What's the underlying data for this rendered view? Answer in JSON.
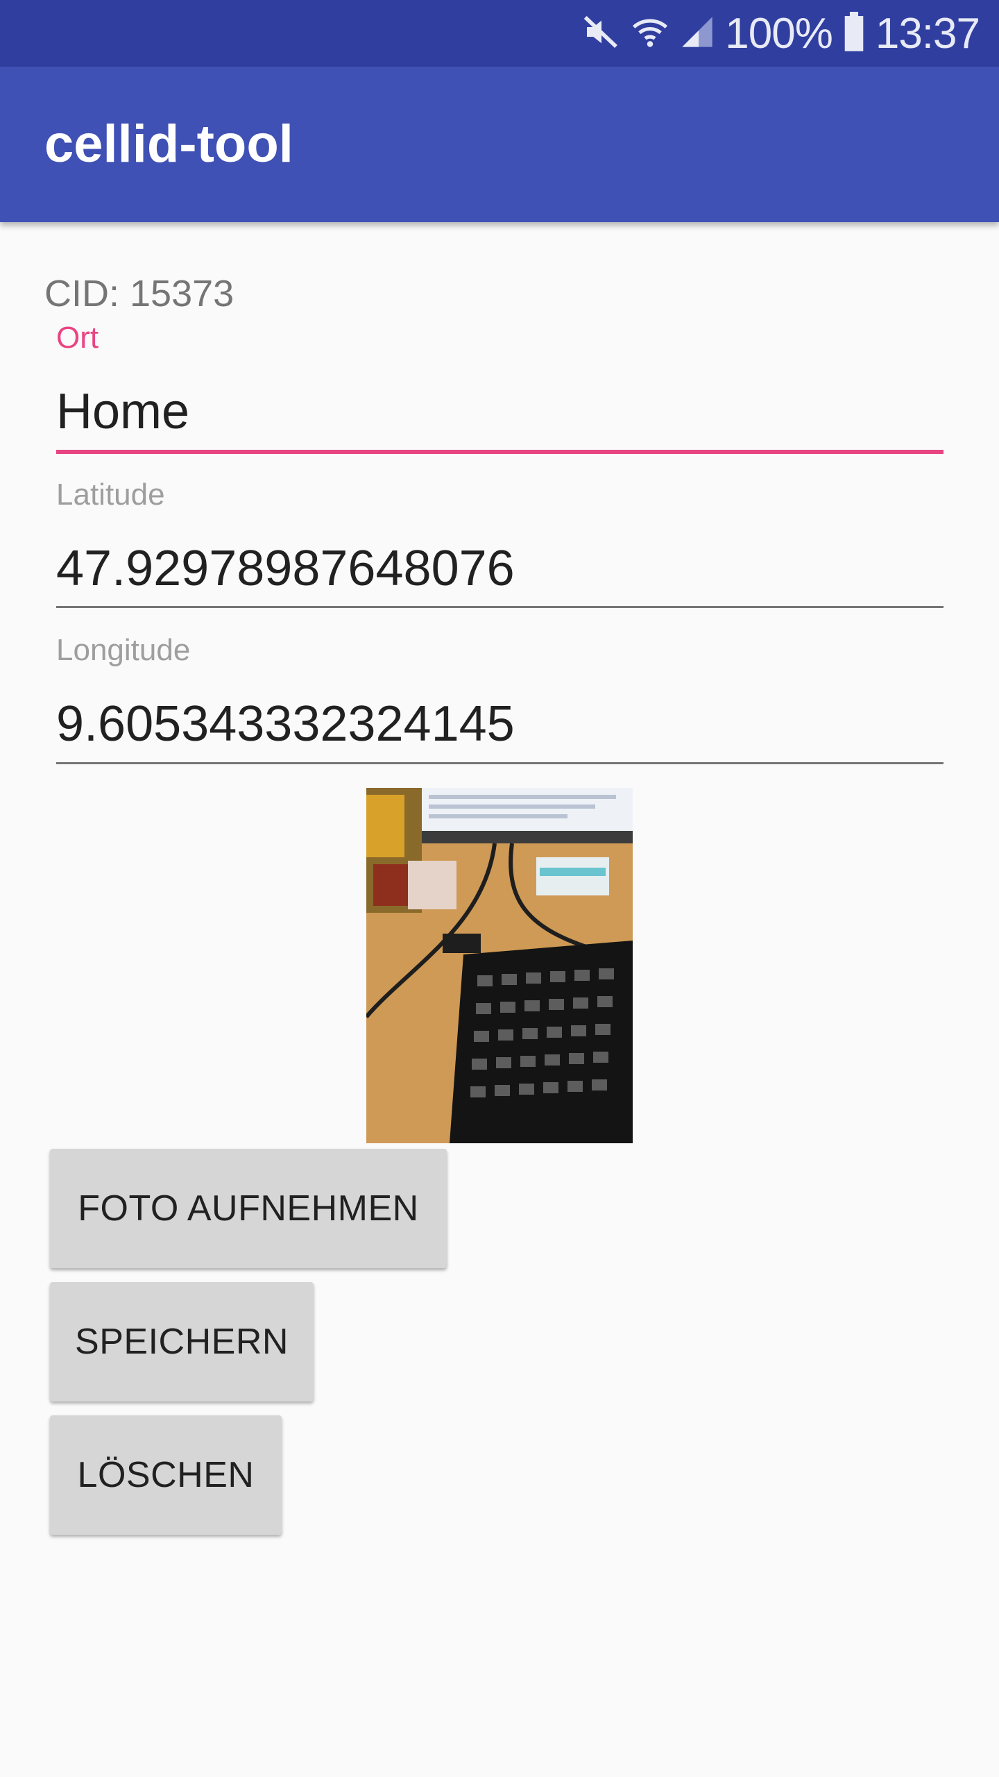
{
  "status_bar": {
    "battery_percent": "100%",
    "time": "13:37",
    "icons": [
      "mute-icon",
      "wifi-icon",
      "signal-icon",
      "battery-icon"
    ]
  },
  "app_bar": {
    "title": "cellid-tool",
    "color": "#3f51b5"
  },
  "form": {
    "cid": "CID: 15373",
    "ort": {
      "label": "Ort",
      "value": "Home"
    },
    "latitude": {
      "label": "Latitude",
      "value": "47.92978987648076"
    },
    "longitude": {
      "label": "Longitude",
      "value": "9.605343332324145"
    },
    "accent_color": "#e84583"
  },
  "photo": {
    "icon": "photo-thumbnail"
  },
  "buttons": {
    "foto": "FOTO AUFNEHMEN",
    "save": "SPEICHERN",
    "delete": "LÖSCHEN"
  }
}
